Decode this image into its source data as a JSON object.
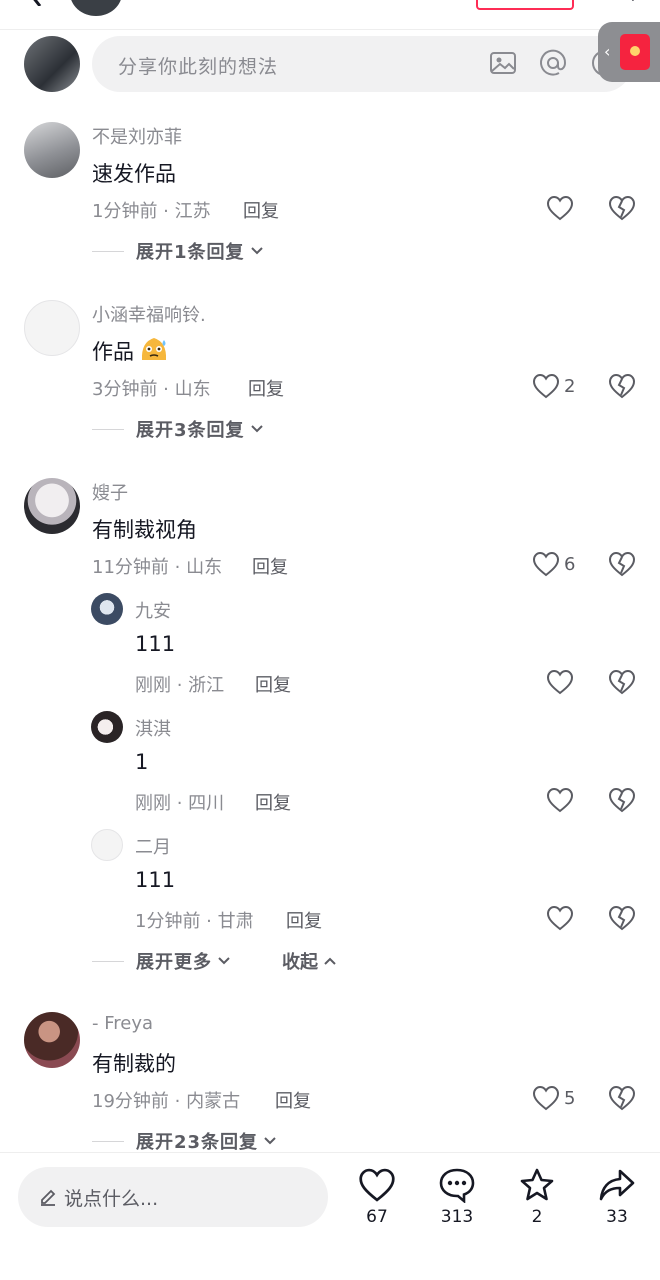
{
  "composer": {
    "placeholder": "分享你此刻的想法"
  },
  "comments": [
    {
      "username": "不是刘亦菲",
      "text": "速发作品",
      "time": "1分钟前 · 江苏",
      "reply_label": "回复",
      "likes": "",
      "expand": "展开1条回复"
    },
    {
      "username": "小涵幸福响铃.",
      "text": "作品",
      "time": "3分钟前 · 山东",
      "reply_label": "回复",
      "likes": "2",
      "expand": "展开3条回复"
    },
    {
      "username": "嫂子",
      "text": "有制裁视角",
      "time": "11分钟前 · 山东",
      "reply_label": "回复",
      "likes": "6",
      "replies": [
        {
          "username": "九安",
          "text": "111",
          "time": "刚刚 · 浙江",
          "reply_label": "回复",
          "likes": ""
        },
        {
          "username": "淇淇",
          "text": "1",
          "time": "刚刚 · 四川",
          "reply_label": "回复",
          "likes": ""
        },
        {
          "username": "二月",
          "text": "111",
          "time": "1分钟前 · 甘肃",
          "reply_label": "回复",
          "likes": ""
        }
      ],
      "expand": "展开更多",
      "collapse": "收起"
    },
    {
      "username": "- Freya",
      "text": "有制裁的",
      "time": "19分钟前 · 内蒙古",
      "reply_label": "回复",
      "likes": "5",
      "expand": "展开23条回复"
    }
  ],
  "bottom": {
    "placeholder": "说点什么...",
    "like_count": "67",
    "comment_count": "313",
    "favorite_count": "2",
    "share_count": "33"
  },
  "colors": {
    "accent": "#fe2c55",
    "secondary_text": "#8a8b91",
    "primary_text": "#161823"
  }
}
